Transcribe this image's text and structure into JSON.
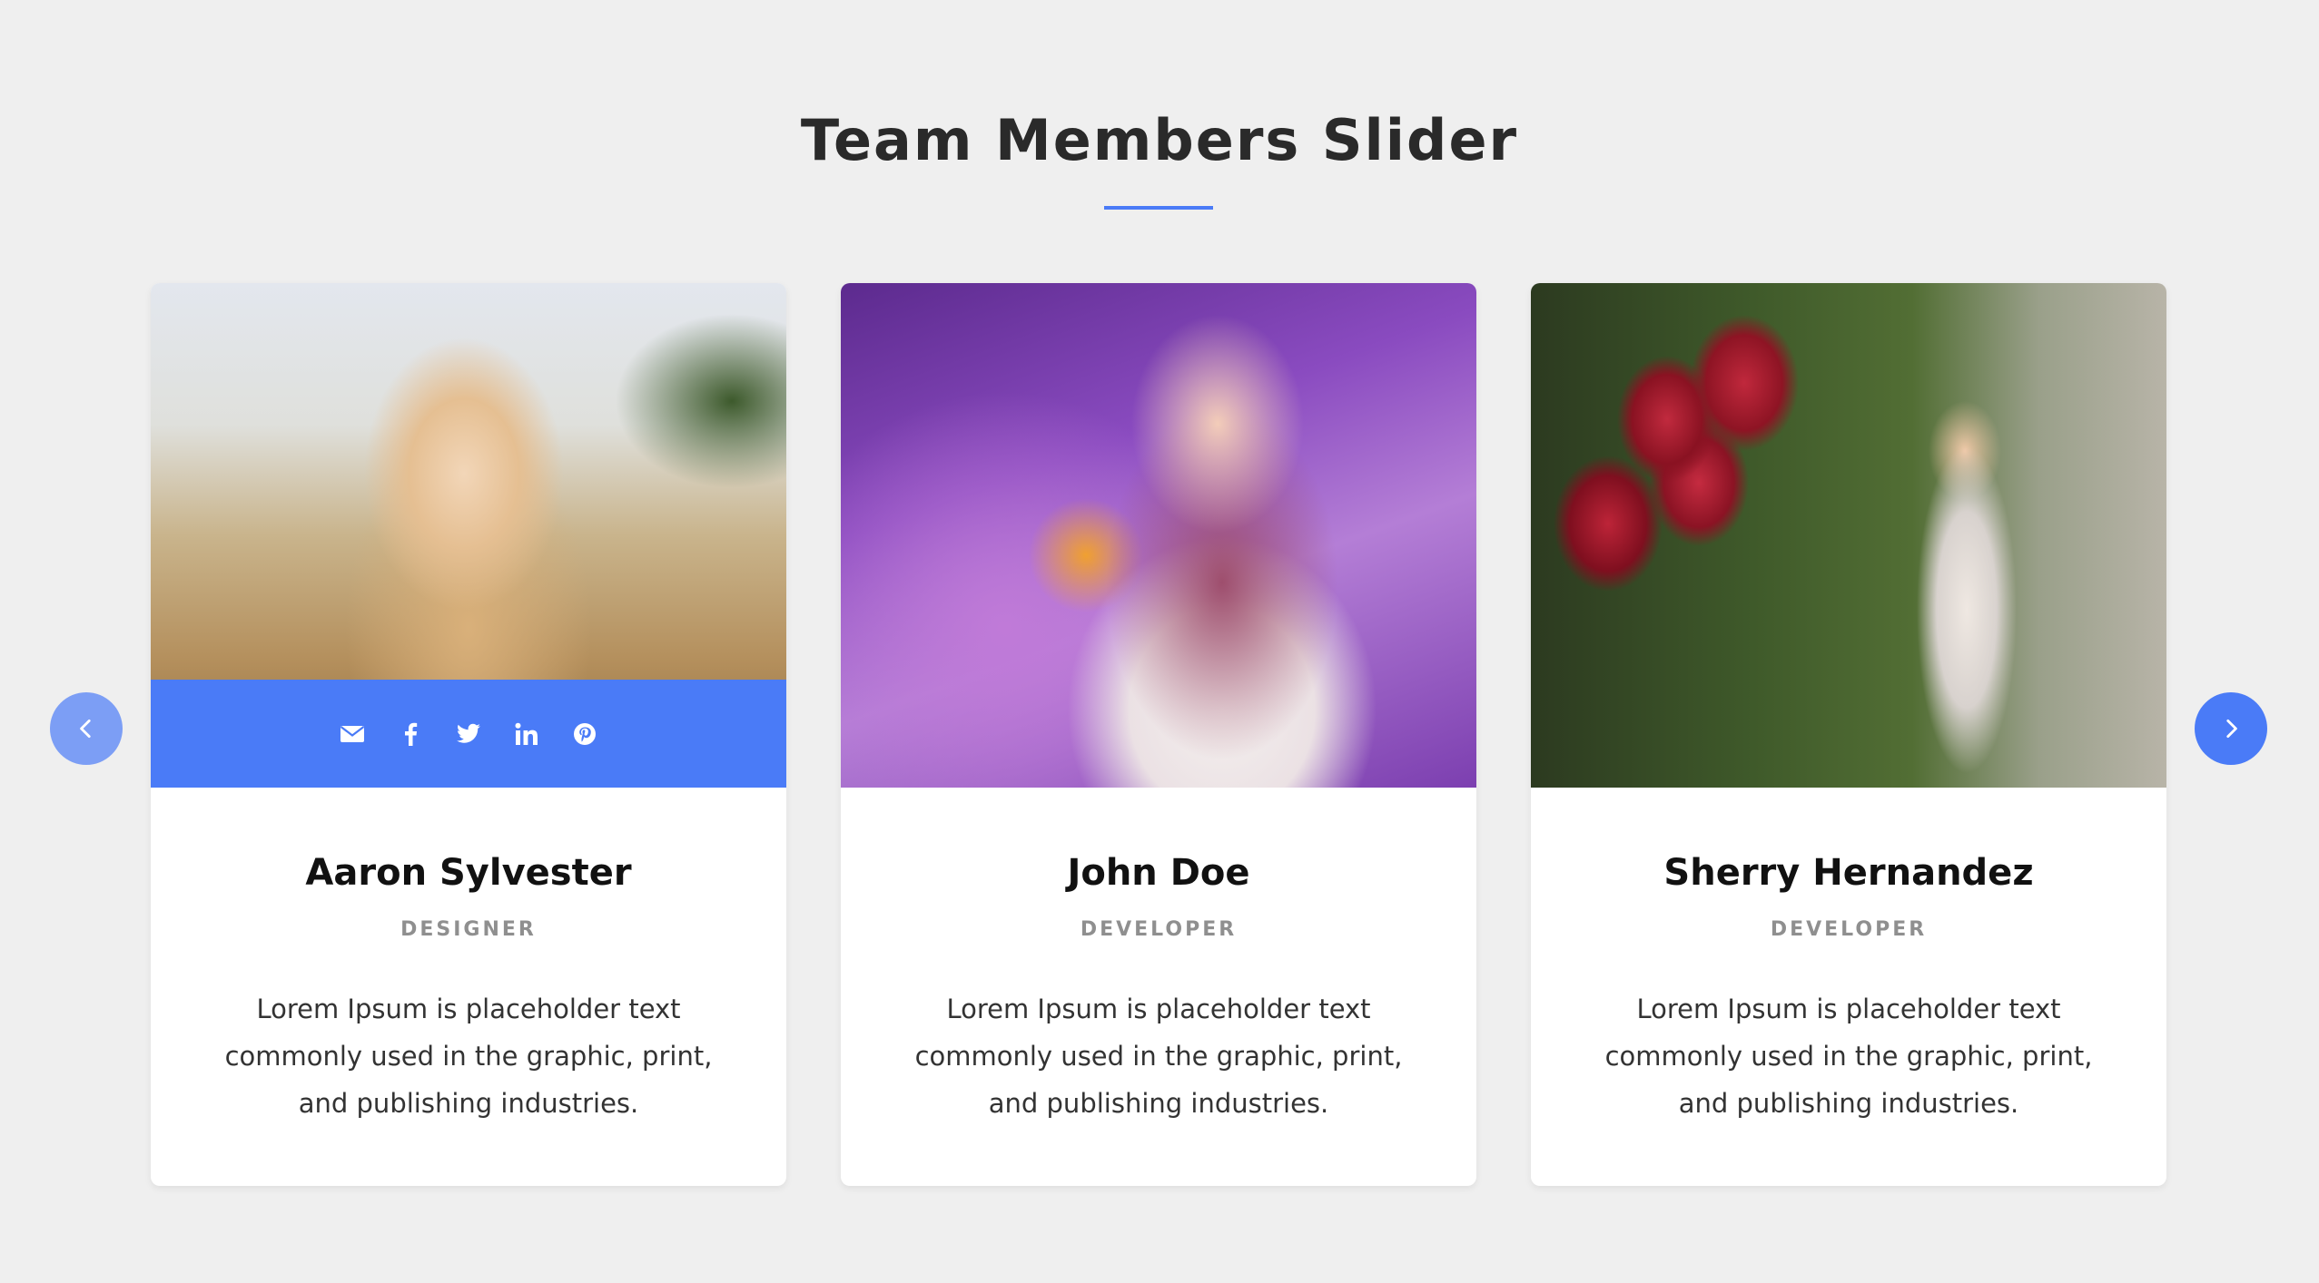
{
  "section": {
    "title": "Team Members Slider"
  },
  "colors": {
    "accent": "#4a7bf7",
    "background": "#efefef",
    "card": "#ffffff"
  },
  "social_icons": [
    "envelope-icon",
    "facebook-icon",
    "twitter-icon",
    "linkedin-icon",
    "pinterest-icon"
  ],
  "members": [
    {
      "name": "Aaron Sylvester",
      "role": "DESIGNER",
      "bio": "Lorem Ipsum is placeholder text commonly used in the graphic, print, and publishing industries.",
      "social_bar_visible": true
    },
    {
      "name": "John Doe",
      "role": "DEVELOPER",
      "bio": "Lorem Ipsum is placeholder text commonly used in the graphic, print, and publishing industries.",
      "social_bar_visible": false
    },
    {
      "name": "Sherry Hernandez",
      "role": "DEVELOPER",
      "bio": "Lorem Ipsum is placeholder text commonly used in the graphic, print, and publishing industries.",
      "social_bar_visible": false
    }
  ],
  "navigation": {
    "prev_icon": "chevron-left-icon",
    "next_icon": "chevron-right-icon"
  }
}
